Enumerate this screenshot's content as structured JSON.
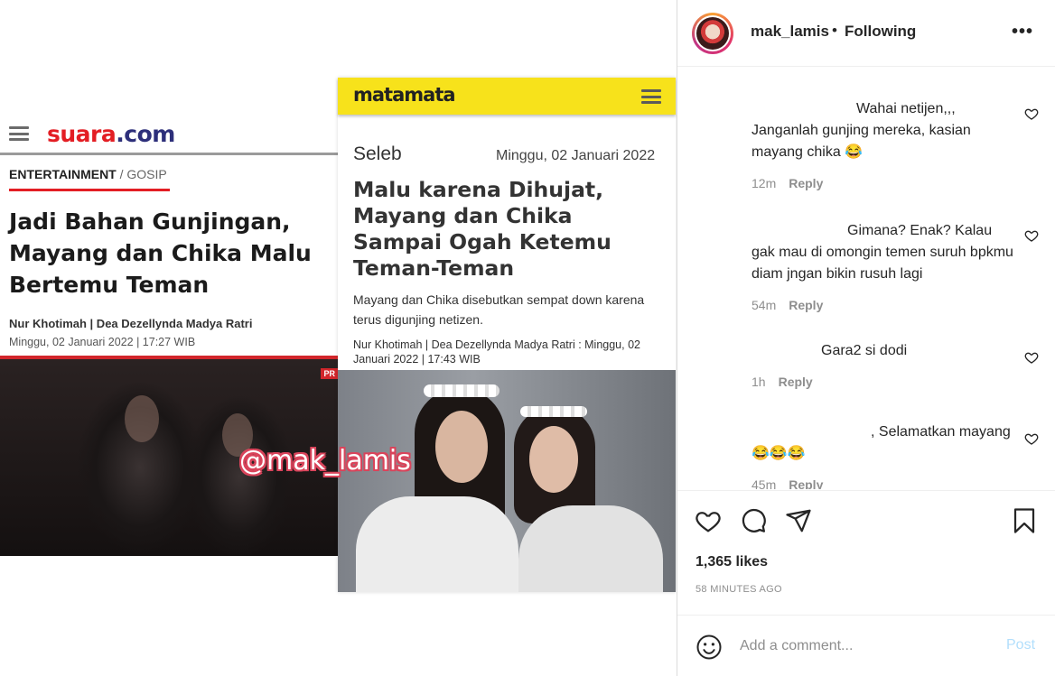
{
  "suara": {
    "logo_prefix": "suara",
    "logo_suffix": ".com",
    "category": "ENTERTAINMENT",
    "category_sep": " / ",
    "subcategory": "GOSIP",
    "headline": "Jadi Bahan Gunjingan, Mayang dan Chika Malu Bertemu Teman",
    "authors": "Nur Khotimah | Dea Dezellynda Madya Ratri",
    "date": "Minggu, 02 Januari 2022 | 17:27 WIB",
    "badge": "PR"
  },
  "watermark": "@mak_lamis",
  "matamata": {
    "logo": "matamata",
    "section": "Seleb",
    "date": "Minggu, 02 Januari 2022",
    "headline": "Malu karena Dihujat, Mayang dan Chika Sampai Ogah Ketemu Teman-Teman",
    "lead": "Mayang dan Chika disebutkan sempat down karena terus digunjing netizen.",
    "byline": "Nur Khotimah | Dea Dezellynda Madya Ratri : Minggu, 02 Januari 2022 | 17:43 WIB"
  },
  "post": {
    "username": "mak_lamis",
    "separator": "•",
    "follow_status": "Following",
    "more_icon": "more-horizontal-icon",
    "comments": [
      {
        "text": "Wahai netijen,,, Janganlah gunjing mereka, kasian mayang chika 😂",
        "time": "12m",
        "reply": "Reply"
      },
      {
        "text": "Gimana? Enak? Kalau gak mau di omongin temen suruh bpkmu diam jngan bikin rusuh lagi",
        "time": "54m",
        "reply": "Reply"
      },
      {
        "text": "Gara2 si dodi",
        "time": "1h",
        "reply": "Reply"
      },
      {
        "text": ", Selamatkan mayang😂😂😂",
        "time": "45m",
        "reply": "Reply"
      }
    ],
    "likes": "1,365 likes",
    "posted": "58 MINUTES AGO",
    "comment_placeholder": "Add a comment...",
    "post_label": "Post",
    "post_label_color": "#b2dffc"
  }
}
